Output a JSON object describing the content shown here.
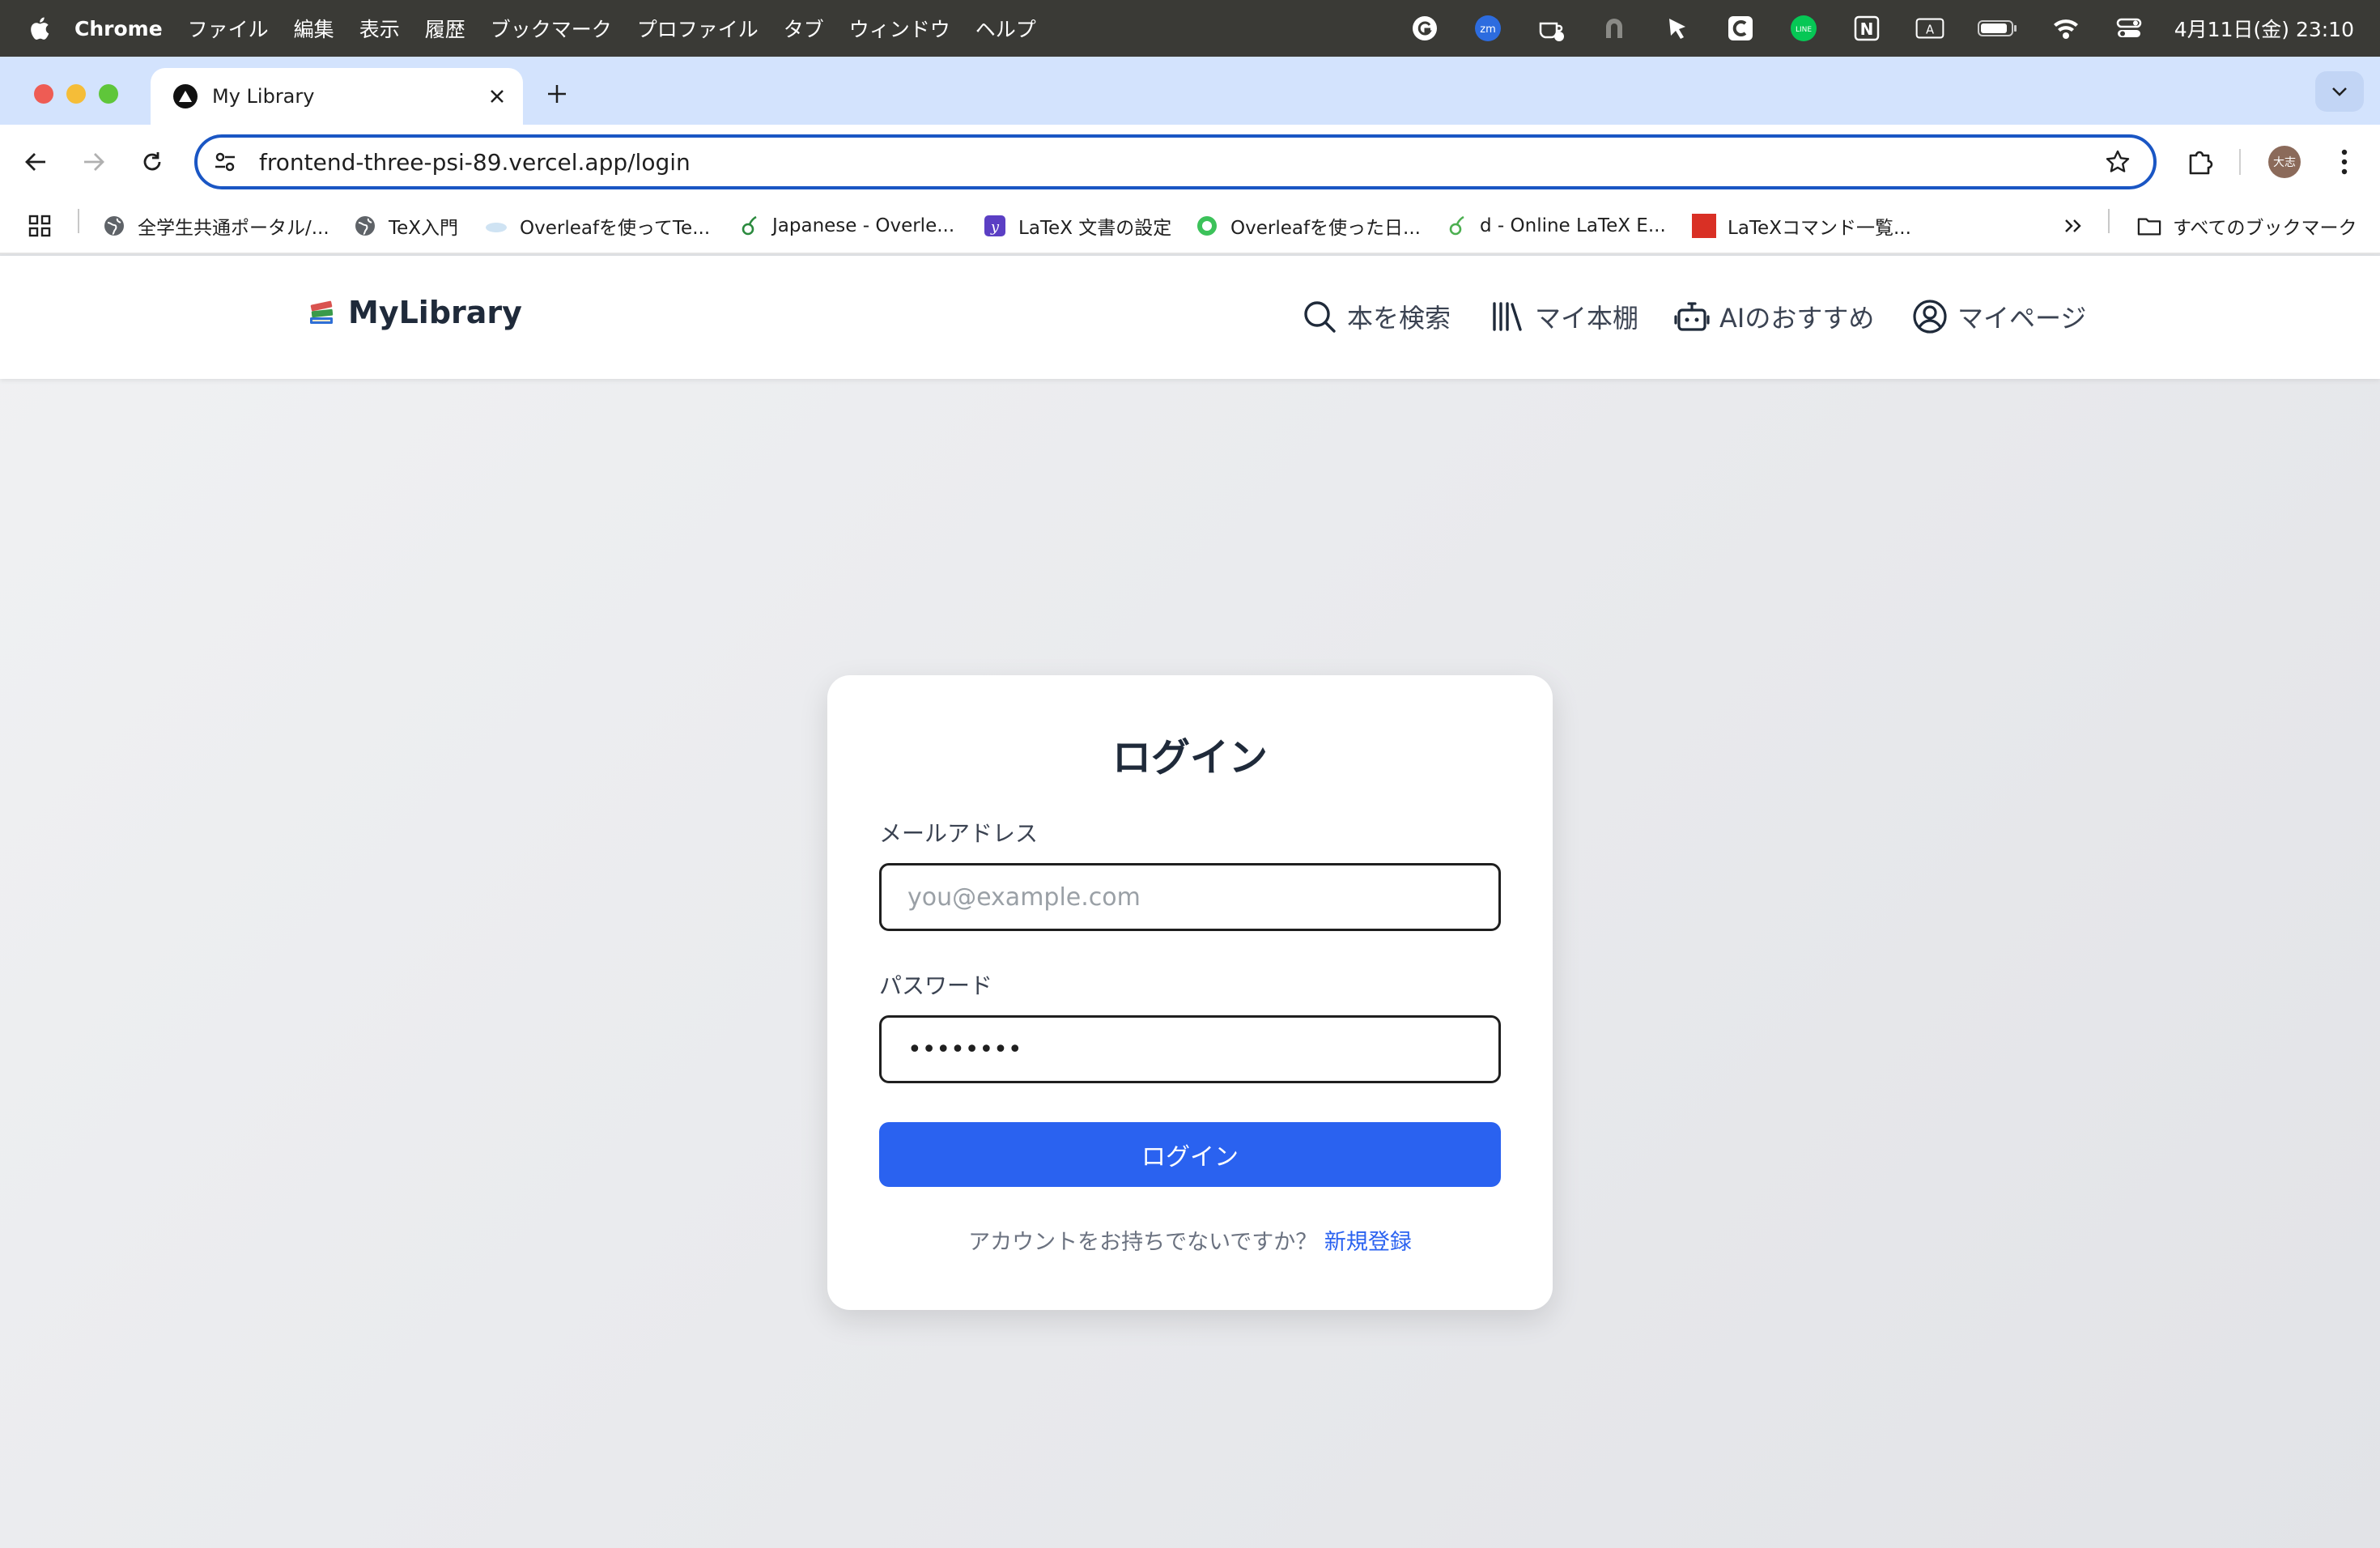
{
  "menubar": {
    "app": "Chrome",
    "items": [
      "ファイル",
      "編集",
      "表示",
      "履歴",
      "ブックマーク",
      "プロファイル",
      "タブ",
      "ウィンドウ",
      "ヘルプ"
    ],
    "clock": "4月11日(金)  23:10",
    "tray_icons": [
      "grammarly-icon",
      "zoom-icon",
      "coffee-icon",
      "arc-icon",
      "pointer-icon",
      "capture-icon",
      "line-icon",
      "notion-icon",
      "input-a-icon",
      "battery-icon",
      "wifi-icon",
      "control-center-icon"
    ],
    "tray_labels": {
      "zoom": "zm",
      "line": "LINE",
      "notion": "N",
      "input": "A"
    }
  },
  "browser": {
    "tab_title": "My Library",
    "url": "frontend-three-psi-89.vercel.app/login",
    "avatar_label": "大志",
    "bookmarks": [
      {
        "label": "全学生共通ポータル/...",
        "icon": "globe-icon"
      },
      {
        "label": "TeX入門",
        "icon": "globe-icon"
      },
      {
        "label": "Overleafを使ってTe...",
        "icon": "cloud-icon"
      },
      {
        "label": "Japanese - Overle...",
        "icon": "overleaf-icon"
      },
      {
        "label": "LaTeX 文書の設定",
        "icon": "yahoo-icon"
      },
      {
        "label": "Overleafを使った日...",
        "icon": "green-circle-icon"
      },
      {
        "label": "d - Online LaTeX E...",
        "icon": "overleaf-icon"
      },
      {
        "label": "LaTeXコマンド一覧...",
        "icon": "red-square-icon"
      }
    ],
    "all_bookmarks": "すべてのブックマーク",
    "colors": {
      "tabstrip": "#d3e3fd",
      "omnibox_border": "#1a56c4"
    }
  },
  "site": {
    "logo": "MyLibrary",
    "nav": {
      "search": "本を検索",
      "shelf": "マイ本棚",
      "ai": "AIのおすすめ",
      "mypage": "マイページ"
    }
  },
  "login": {
    "title": "ログイン",
    "email_label": "メールアドレス",
    "email_placeholder": "you@example.com",
    "password_label": "パスワード",
    "password_value": "••••••••",
    "submit_label": "ログイン",
    "signup_prompt": "アカウントをお持ちでないですか？ ",
    "signup_link": "新規登録",
    "colors": {
      "primary": "#2a62f0"
    }
  }
}
